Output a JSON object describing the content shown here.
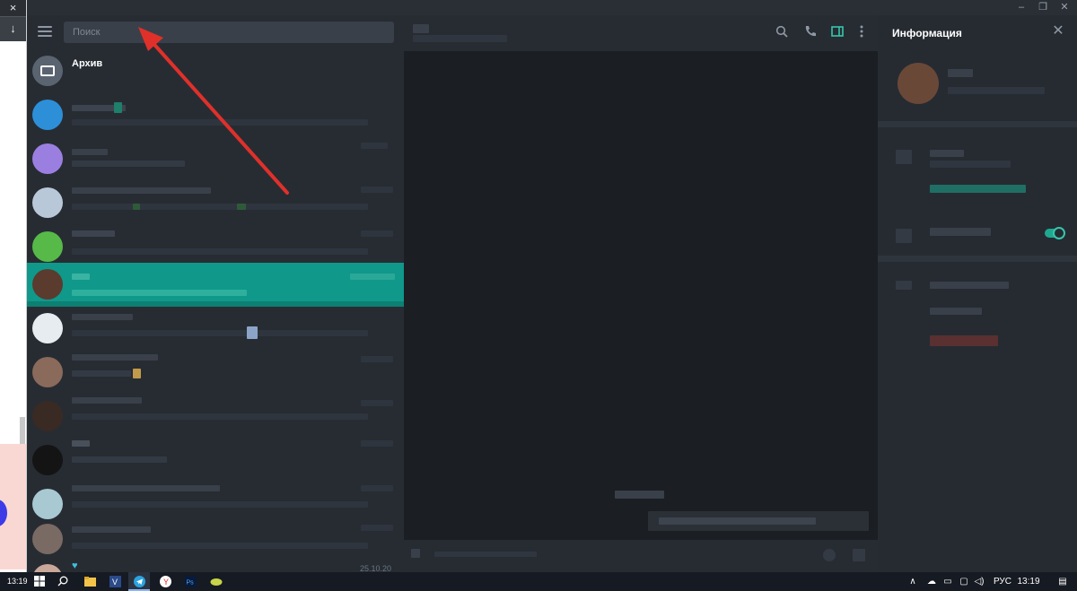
{
  "browser_strip": {
    "close_icon": "×",
    "download_icon": "↓"
  },
  "window": {
    "minimize_icon": "–",
    "restore_icon": "❐",
    "close_icon": "✕"
  },
  "search": {
    "placeholder": "Поиск"
  },
  "chat_list": {
    "archive_label": "Архив",
    "last_row_date": "25.10.20"
  },
  "chat_header": {
    "search_icon": "search-icon",
    "call_icon": "phone-icon",
    "info_panel_icon": "sidebar-icon",
    "more_icon": "more-icon"
  },
  "info_panel": {
    "title": "Информация",
    "close_glyph": "✕"
  },
  "taskbar": {
    "clock_left": "13:19",
    "language": "РУС",
    "clock_right": "13:19",
    "up_arrow": "∧"
  },
  "colors": {
    "accent": "#10988a",
    "annotation": "#e0302a",
    "bg_dark": "#1b1e23",
    "panel": "#272c33"
  }
}
